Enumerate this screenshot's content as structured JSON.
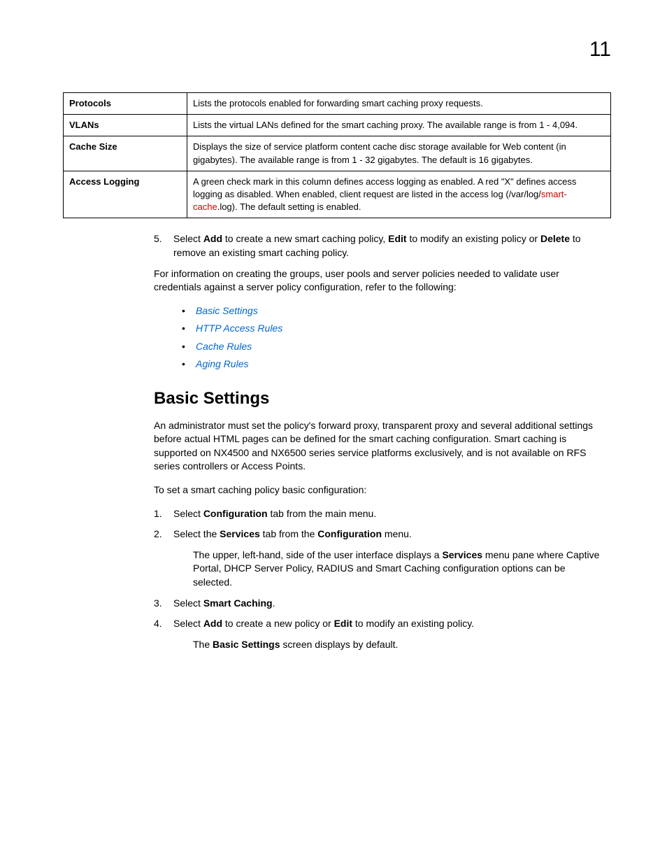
{
  "pageNumber": "11",
  "table": {
    "rows": [
      {
        "label": "Protocols",
        "desc_html": "Lists the protocols enabled for forwarding smart caching proxy requests."
      },
      {
        "label": "VLANs",
        "desc_html": "Lists the virtual LANs defined for the smart caching proxy. The available range is from 1 - 4,094."
      },
      {
        "label": "Cache Size",
        "desc_html": "Displays the size of service platform content cache disc storage available for Web content (in gigabytes). The available range is from 1 - 32 gigabytes. The default is 16 gigabytes."
      },
      {
        "label": "Access Logging",
        "desc_html": "A green check mark in this column defines access logging as enabled. A red \"X\" defines access logging as disabled. When enabled, client request are listed in the access log (/var/log/<span class=\"red\">smart-cache</span>.log). The default setting is enabled."
      }
    ]
  },
  "step5": {
    "num": "5.",
    "html": "Select <span class=\"bold\">Add</span> to create a new smart caching policy, <span class=\"bold\">Edit</span> to modify an existing policy or <span class=\"bold\">Delete</span> to remove an existing smart caching policy."
  },
  "para_info": "For information on creating the groups, user pools and server policies needed to validate user credentials against a server policy configuration, refer to the following:",
  "links": [
    "Basic Settings",
    "HTTP Access Rules",
    "Cache Rules",
    "Aging Rules"
  ],
  "section": {
    "title": "Basic Settings",
    "intro": "An administrator must set the policy's forward proxy, transparent proxy and several additional settings before actual HTML pages can be defined for the smart caching configuration. Smart caching is supported on NX4500 and NX6500 series service platforms exclusively, and is not available on RFS series controllers or Access Points.",
    "lead": "To set a smart caching policy basic configuration:",
    "steps": [
      {
        "num": "1.",
        "html": "Select <span class=\"bold\">Configuration</span> tab from the main menu."
      },
      {
        "num": "2.",
        "html": "Select the <span class=\"bold\">Services</span> tab from the <span class=\"bold\">Configuration</span> menu."
      }
    ],
    "step2note_html": "The upper, left-hand, side of the user interface displays a <span class=\"bold\">Services</span> menu pane where Captive Portal, DHCP Server Policy, RADIUS and Smart Caching configuration options can be selected.",
    "step3": {
      "num": "3.",
      "html": "Select <span class=\"bold\">Smart Caching</span>."
    },
    "step4": {
      "num": "4.",
      "html": "Select <span class=\"bold\">Add</span> to create a new policy or <span class=\"bold\">Edit</span> to modify an existing policy."
    },
    "step4note_html": "The <span class=\"bold\">Basic Settings</span> screen displays by default."
  }
}
